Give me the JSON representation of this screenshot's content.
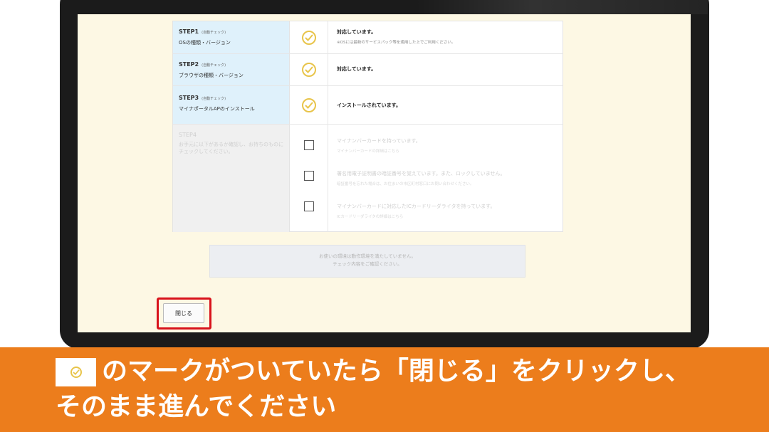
{
  "steps": [
    {
      "title": "STEP1",
      "tag": "(自動チェック)",
      "desc": "OSの種類・バージョン",
      "status": "対応しています。",
      "note": "※OSには最新のサービスパック等を適用した上でご利用ください。"
    },
    {
      "title": "STEP2",
      "tag": "(自動チェック)",
      "desc": "ブラウザの種類・バージョン",
      "status": "対応しています。",
      "note": ""
    },
    {
      "title": "STEP3",
      "tag": "(自動チェック)",
      "desc": "マイナポータルAPのインストール",
      "status": "インストールされています。",
      "note": ""
    }
  ],
  "step4": {
    "title": "STEP4",
    "desc": "お手元に以下があるか確認し、お持ちのものにチェックしてください。",
    "items": [
      {
        "label": "マイナンバーカードを持っています。",
        "note": "マイナンバーカードの詳細はこちら"
      },
      {
        "label": "署名用電子証明書の暗証番号を覚えています。また、ロックしていません。",
        "note": "暗証番号を忘れた場合は、お住まいの市区町村窓口にお問い合わせください。"
      },
      {
        "label": "マイナンバーカードに対応したICカードリーダライタを持っています。",
        "note": "ICカードリーダライタの詳細はこちら"
      }
    ]
  },
  "notice": {
    "line1": "お使いの環境は動作環境を満たしていません。",
    "line2": "チェック内容をご確認ください。"
  },
  "close_button": {
    "label": "閉じる"
  },
  "caption": {
    "line1": "のマークがついていたら「閉じる」をクリックし、",
    "line2": "そのまま進んでください"
  },
  "colors": {
    "banner": "#ec7d1c",
    "highlight": "#d8131b",
    "check": "#e8c44a",
    "label_bg": "#dff1fb",
    "screen_bg": "#fdf8e4"
  },
  "icons": {
    "status_ok": "check-circle-icon",
    "step4_option": "checkbox-icon"
  }
}
